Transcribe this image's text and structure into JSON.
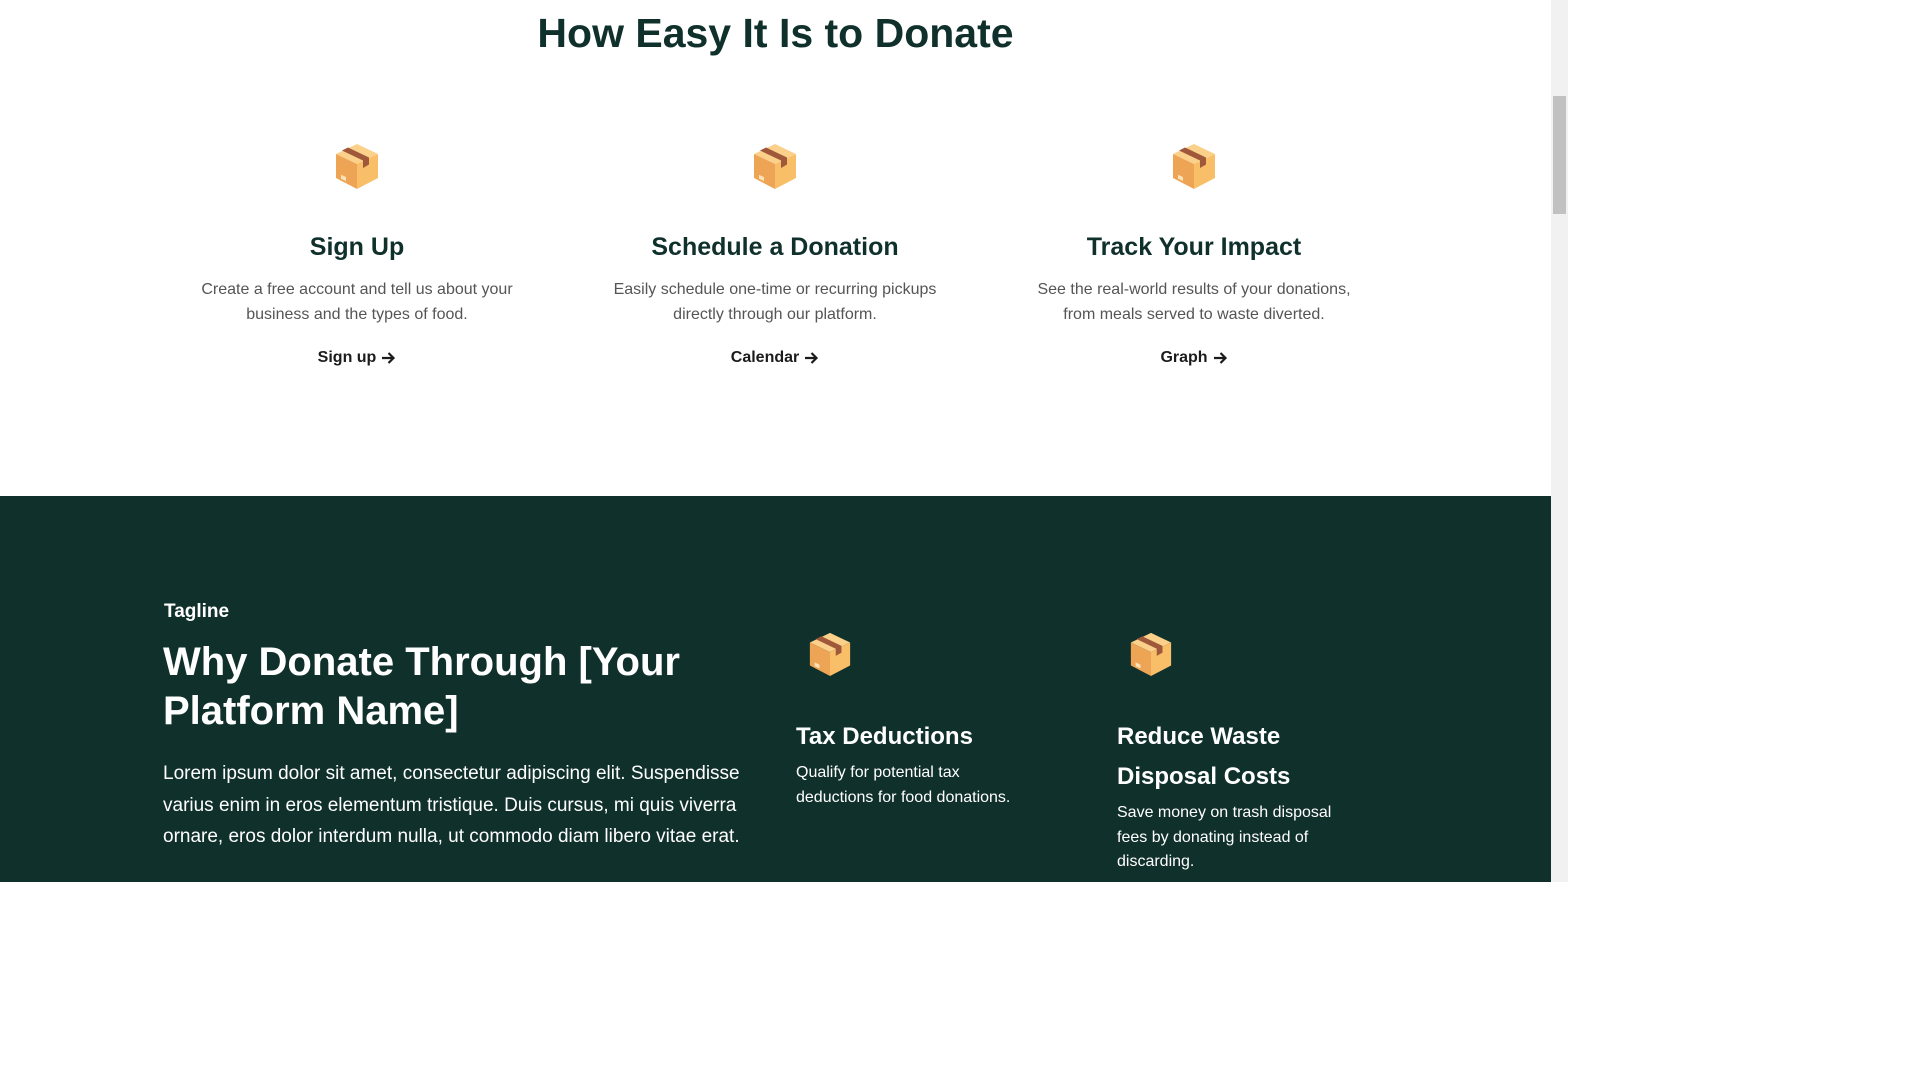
{
  "how_section": {
    "title": "How Easy It Is to Donate",
    "steps": [
      {
        "icon": "package-icon",
        "title": "Sign Up",
        "description": "Create a free account and tell us about your business and the types of food.",
        "link_label": "Sign up"
      },
      {
        "icon": "package-icon",
        "title": "Schedule a Donation",
        "description": "Easily schedule one-time or recurring pickups directly through our platform.",
        "link_label": "Calendar"
      },
      {
        "icon": "package-icon",
        "title": "Track Your Impact",
        "description": "See the real-world results of your donations, from meals served to waste diverted.",
        "link_label": "Graph"
      }
    ]
  },
  "why_section": {
    "tagline": "Tagline",
    "title": "Why Donate Through [Your Platform Name]",
    "body": "Lorem ipsum dolor sit amet, consectetur adipiscing elit. Suspendisse varius enim in eros elementum tristique. Duis cursus, mi quis viverra ornare, eros dolor interdum nulla, ut commodo diam libero vitae erat.",
    "benefits": [
      {
        "icon": "package-icon",
        "title": "Tax Deductions",
        "description": "Qualify for potential tax deductions for food donations."
      },
      {
        "icon": "package-icon",
        "title": "Reduce Waste Disposal Costs",
        "description": "Save money on trash disposal fees by donating instead of discarding."
      }
    ]
  },
  "colors": {
    "dark_green": "#10302b",
    "white": "#ffffff",
    "body_text_gray": "#555555",
    "box_light": "#f7c06d",
    "box_dark": "#e39a4d",
    "box_tape": "#a0583b"
  }
}
